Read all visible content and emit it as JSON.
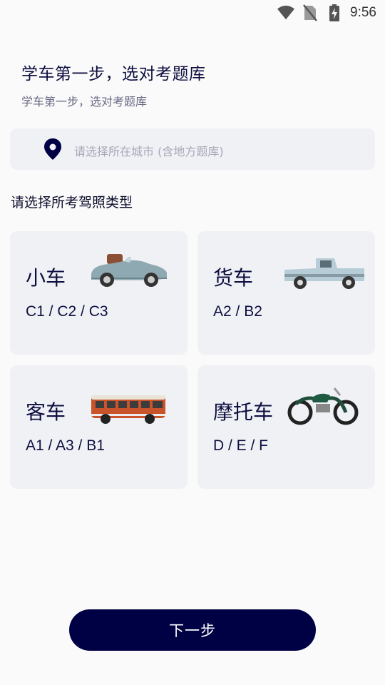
{
  "status_bar": {
    "time": "9:56"
  },
  "header": {
    "title": "学车第一步，选对考题库",
    "subtitle": "学车第一步，选对考题库"
  },
  "city_search": {
    "placeholder": "请选择所在城市 (含地方题库)",
    "icon": "location-pin-icon"
  },
  "section_title": "请选择所考驾照类型",
  "license_types": [
    {
      "name": "小车",
      "codes": "C1 / C2 / C3",
      "image": "convertible-car"
    },
    {
      "name": "货车",
      "codes": "A2 / B2",
      "image": "pickup-truck"
    },
    {
      "name": "客车",
      "codes": "A1 / A3 / B1",
      "image": "bus"
    },
    {
      "name": "摩托车",
      "codes": "D / E / F",
      "image": "motorcycle"
    }
  ],
  "next_button": {
    "label": "下一步"
  },
  "colors": {
    "primary": "#000044",
    "card_bg": "#f0f1f5",
    "text": "#0e0e40"
  }
}
